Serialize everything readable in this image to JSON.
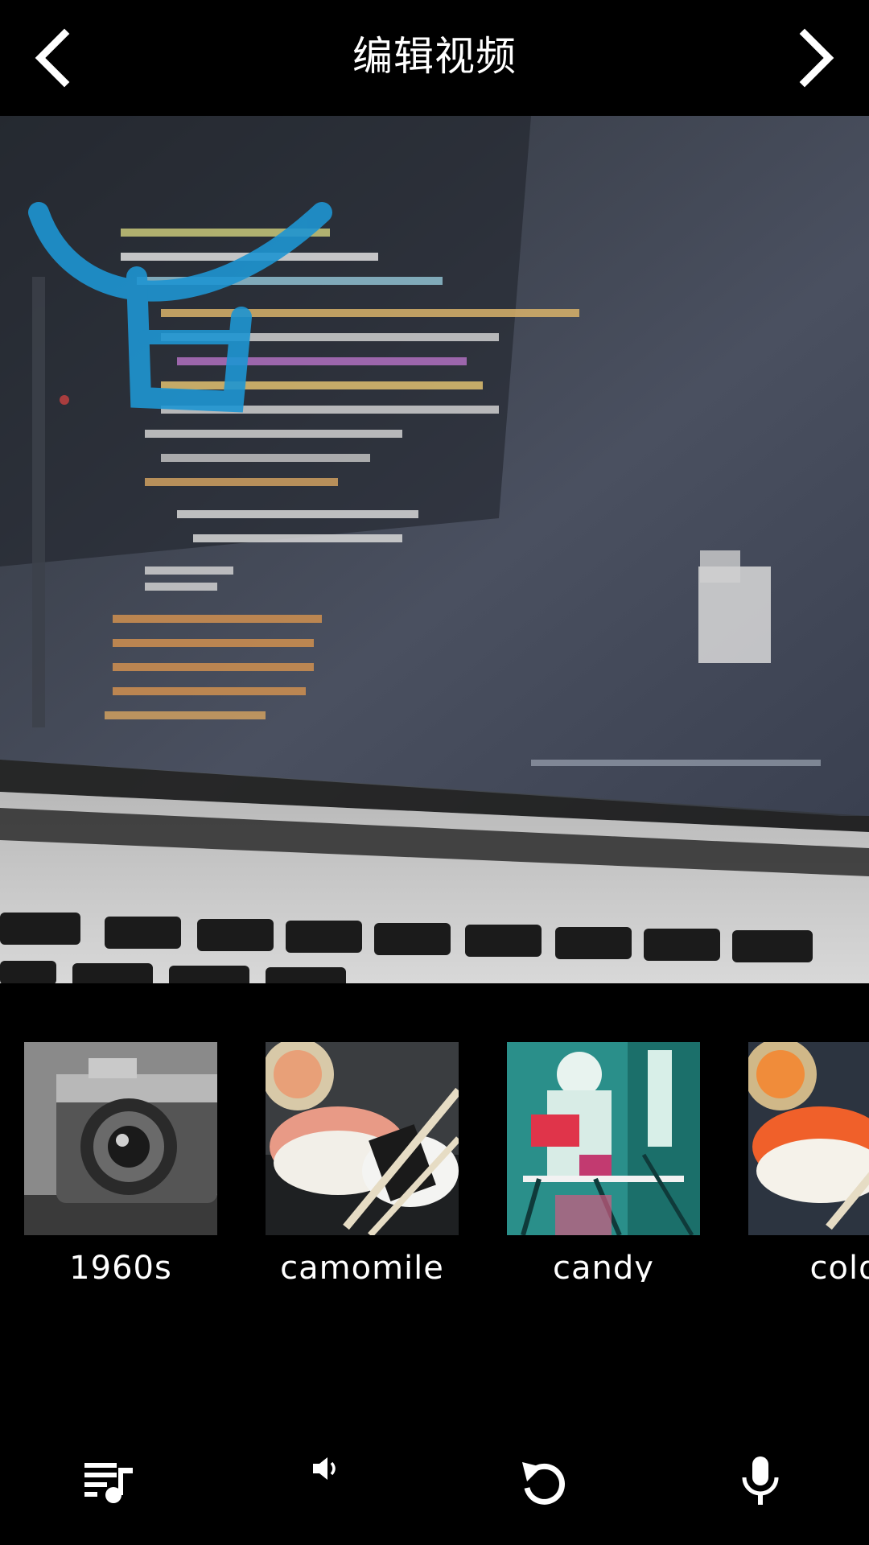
{
  "header": {
    "title": "编辑视频",
    "back_icon": "chevron-left-icon",
    "forward_icon": "chevron-right-icon"
  },
  "video": {
    "watermark_color": "#1e95d2"
  },
  "filters": [
    {
      "label": "1960s"
    },
    {
      "label": "camomile"
    },
    {
      "label": "candy"
    },
    {
      "label": "cold"
    }
  ],
  "toolbar": {
    "icons": [
      "music-playlist-icon",
      "volume-icon",
      "undo-icon",
      "microphone-icon"
    ]
  },
  "colors": {
    "background": "#000000",
    "text": "#ffffff"
  }
}
